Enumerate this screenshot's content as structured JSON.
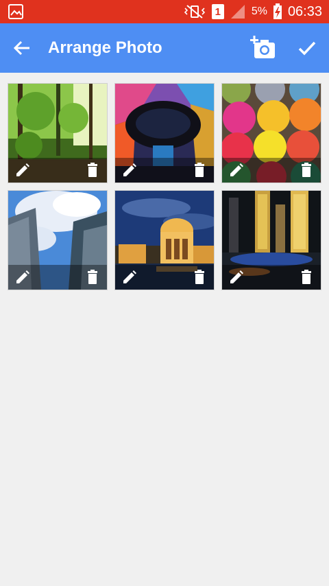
{
  "status_bar": {
    "battery_percent": "5%",
    "time": "06:33",
    "sim_slot": "1",
    "color": "#e0321e"
  },
  "toolbar": {
    "title": "Arrange Photo",
    "color": "#4e8ef3",
    "back_icon": "arrow-back-icon",
    "add_photo_icon": "add-a-photo-icon",
    "confirm_icon": "check-icon"
  },
  "photos": [
    {
      "subject": "forest",
      "edit_icon": "pencil-icon",
      "delete_icon": "trash-icon"
    },
    {
      "subject": "stained-glass-dome",
      "edit_icon": "pencil-icon",
      "delete_icon": "trash-icon"
    },
    {
      "subject": "yarn-balls",
      "edit_icon": "pencil-icon",
      "delete_icon": "trash-icon"
    },
    {
      "subject": "skyscrapers-sky",
      "edit_icon": "pencil-icon",
      "delete_icon": "trash-icon"
    },
    {
      "subject": "palace-night",
      "edit_icon": "pencil-icon",
      "delete_icon": "trash-icon"
    },
    {
      "subject": "city-night",
      "edit_icon": "pencil-icon",
      "delete_icon": "trash-icon"
    }
  ]
}
